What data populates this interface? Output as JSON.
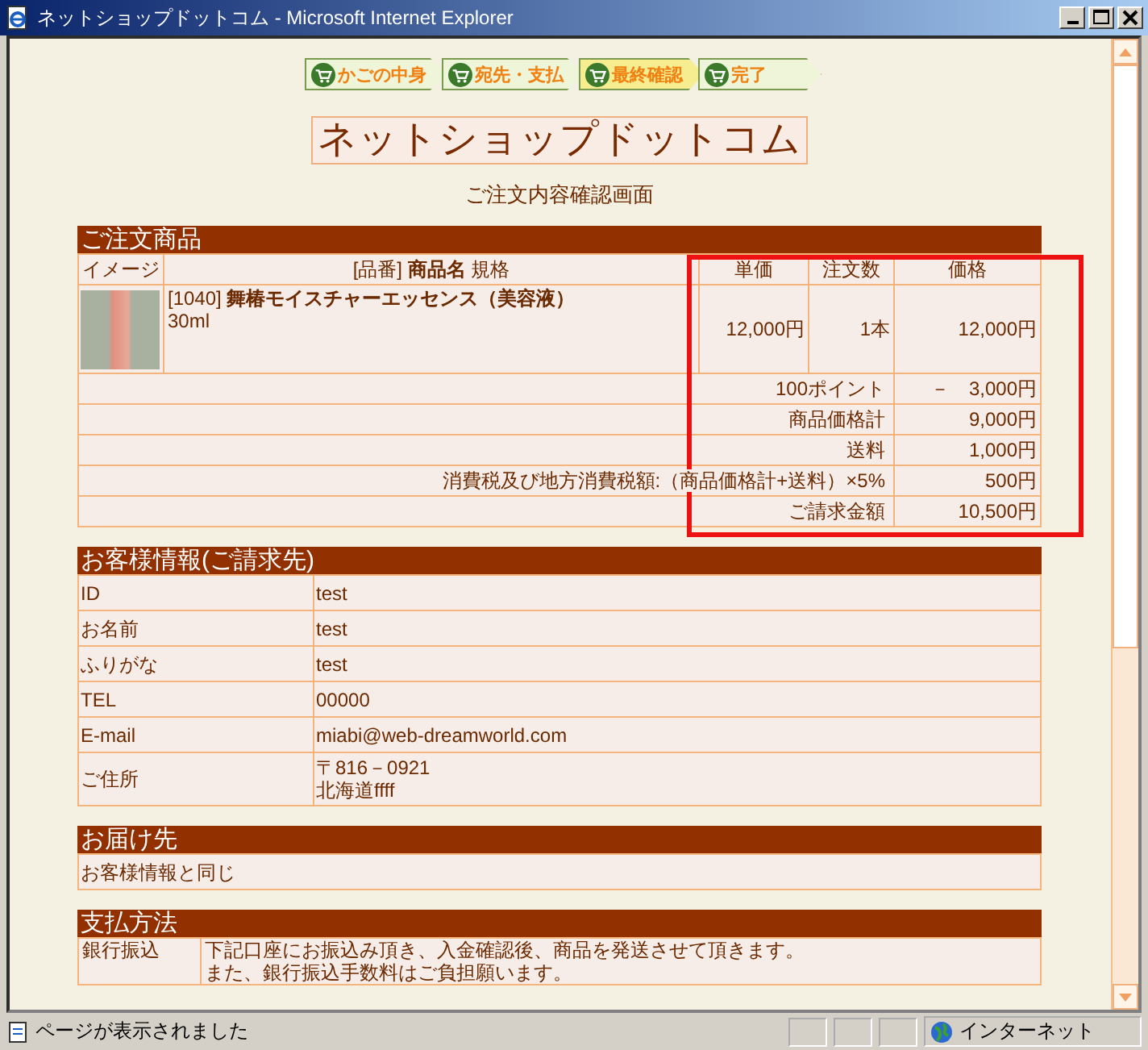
{
  "window": {
    "title": "ネットショップドットコム - Microsoft Internet Explorer"
  },
  "steps": [
    {
      "label": "かごの中身",
      "selected": false
    },
    {
      "label": "宛先・支払",
      "selected": false
    },
    {
      "label": "最終確認",
      "selected": true
    },
    {
      "label": "完了",
      "selected": false
    }
  ],
  "shop_title": "ネットショップドットコム",
  "subtitle": "ご注文内容確認画面",
  "order": {
    "heading": "ご注文商品",
    "columns": [
      "イメージ",
      "[品番] **商品名** 規格",
      "単価",
      "注文数",
      "価格"
    ],
    "items": [
      {
        "name": "[1040] **舞椿モイスチャーエッセンス（美容液）**",
        "spec": "30ml",
        "unit_price": "12,000円",
        "quantity": "1本",
        "price": "12,000円"
      }
    ],
    "summary": [
      {
        "label": "100ポイント",
        "value": "－　3,000円"
      },
      {
        "label": "商品価格計",
        "value": "9,000円"
      },
      {
        "label": "送料",
        "value": "1,000円"
      },
      {
        "label": "消費税及び地方消費税額:（商品価格計+送料）×5%",
        "value": "500円"
      },
      {
        "label": "ご請求金額",
        "value": "10,500円"
      }
    ]
  },
  "customer": {
    "heading": "お客様情報(ご請求先)",
    "rows": [
      {
        "label": "ID",
        "lines": [
          "test"
        ]
      },
      {
        "label": "お名前",
        "lines": [
          "test"
        ]
      },
      {
        "label": "ふりがな",
        "lines": [
          "test"
        ]
      },
      {
        "label": "TEL",
        "lines": [
          "00000"
        ]
      },
      {
        "label": "E-mail",
        "lines": [
          "miabi@web-dreamworld.com"
        ]
      },
      {
        "label": "ご住所",
        "lines": [
          "〒816－0921",
          "北海道ffff"
        ]
      }
    ]
  },
  "delivery": {
    "heading": "お届け先",
    "text": "お客様情報と同じ"
  },
  "payment": {
    "heading": "支払方法",
    "method": "銀行振込",
    "lines": [
      "下記口座にお振込み頂き、入金確認後、商品を発送させて頂きます。",
      "また、銀行振込手数料はご負担願います。"
    ]
  },
  "status_bar": {
    "message": "ページが表示されました",
    "zone": "インターネット"
  }
}
